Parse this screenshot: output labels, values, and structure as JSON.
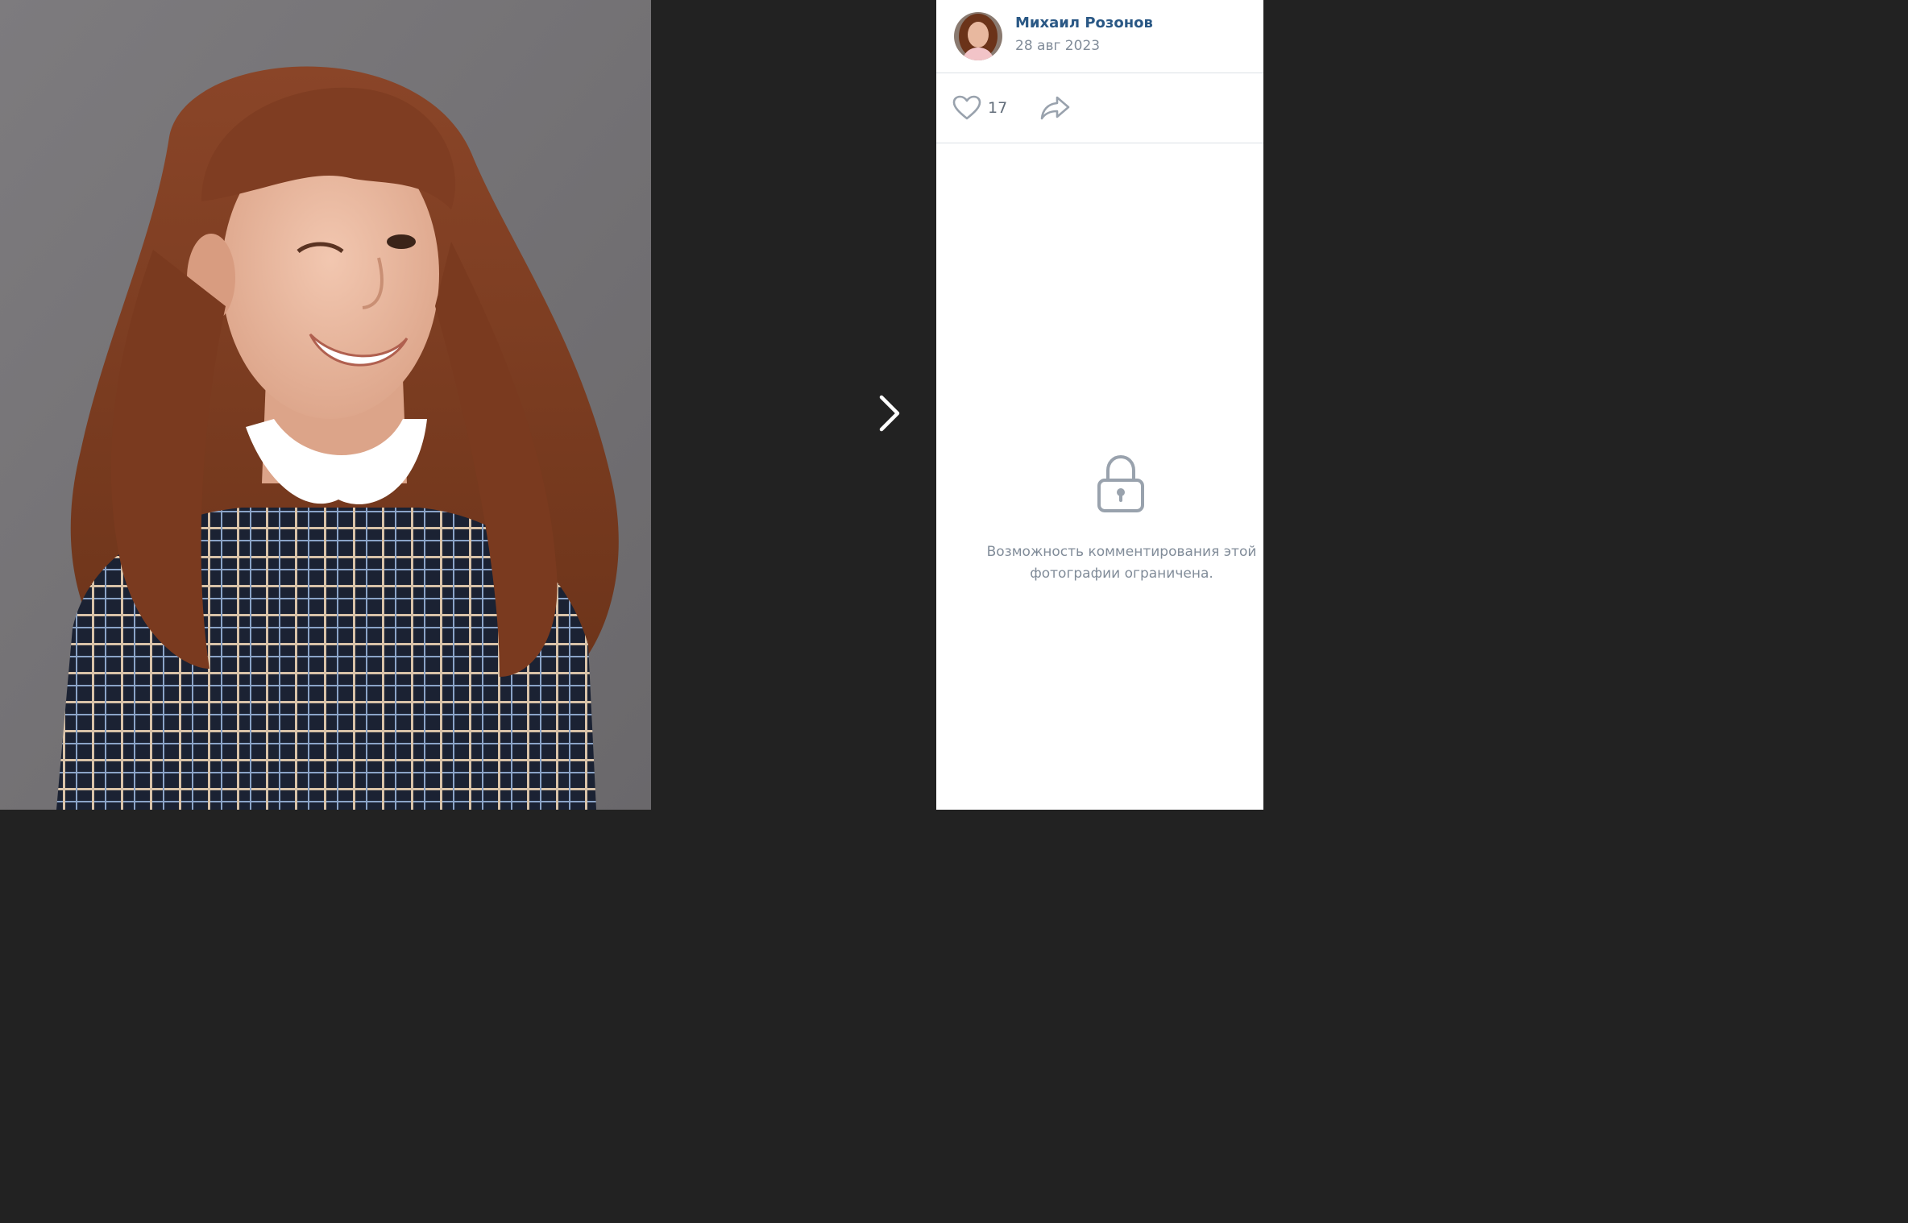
{
  "post": {
    "author_name": "Михаил Розонов",
    "date": "28 авг 2023"
  },
  "actions": {
    "likes_count": "17",
    "like_icon": "heart-icon",
    "share_icon": "share-arrow-icon"
  },
  "comments": {
    "restricted_message": "Возможность комментирования этой фотографии ограничена.",
    "icon": "lock-icon"
  },
  "viewer": {
    "next_icon": "chevron-right-icon"
  },
  "colors": {
    "viewer_bg": "#222222",
    "link": "#2a5885",
    "secondary_text": "#818c99",
    "divider": "#dce1e6"
  }
}
